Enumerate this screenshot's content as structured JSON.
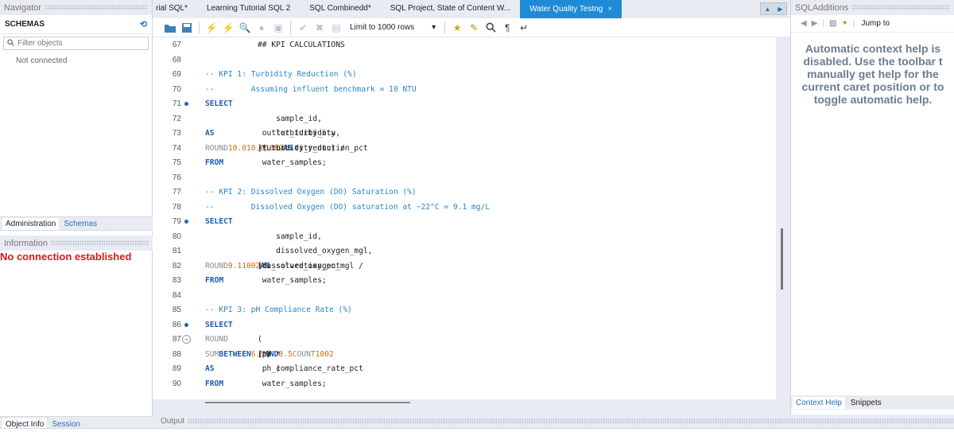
{
  "navigator": {
    "title": "Navigator",
    "schemas_label": "SCHEMAS",
    "filter_placeholder": "Filter objects",
    "status": "Not connected",
    "tabs": [
      "Administration",
      "Schemas"
    ],
    "info_title": "Information",
    "no_connection": "No connection established",
    "bottom_tabs": [
      "Object Info",
      "Session"
    ]
  },
  "document_tabs": [
    {
      "label": "rial SQL*"
    },
    {
      "label": "Learning Tutorial SQL 2"
    },
    {
      "label": "SQL Combinedd*"
    },
    {
      "label": "SQL Project, State of Content W..."
    },
    {
      "label": "Water Quality Testng",
      "active": true,
      "close": "×"
    }
  ],
  "toolbar": {
    "limit_label": "Limit to 1000 rows",
    "dropdown_arrow": "▾"
  },
  "editor": {
    "lines": [
      {
        "n": "67",
        "parts": [
          {
            "t": "## KPI CALCULATIONS",
            "c": "code"
          }
        ]
      },
      {
        "n": "68",
        "parts": []
      },
      {
        "n": "69",
        "parts": [
          {
            "t": "-- KPI 1: Turbidity Reduction (%)",
            "c": "cm"
          }
        ]
      },
      {
        "n": "70",
        "parts": [
          {
            "t": "--        Assuming influent benchmark = 10 NTU",
            "c": "cm"
          }
        ]
      },
      {
        "n": "71",
        "mark": true,
        "parts": [
          {
            "t": "SELECT",
            "c": "kw"
          }
        ]
      },
      {
        "n": "72",
        "parts": [
          {
            "t": "    sample_id,",
            "c": "code"
          }
        ]
      },
      {
        "n": "73",
        "parts": [
          {
            "t": "    turbidity_ntu ",
            "c": "code"
          },
          {
            "t": "AS",
            "c": "kw"
          },
          {
            "t": " outlet_turbidity,",
            "c": "code"
          }
        ]
      },
      {
        "n": "74",
        "parts": [
          {
            "t": "    ",
            "c": "code"
          },
          {
            "t": "ROUND",
            "c": "fn"
          },
          {
            "t": "((",
            "c": "code"
          },
          {
            "t": "10.0",
            "c": "num"
          },
          {
            "t": " - turbidity_ntu) / ",
            "c": "code"
          },
          {
            "t": "10.0",
            "c": "num"
          },
          {
            "t": " * ",
            "c": "code"
          },
          {
            "t": "100",
            "c": "num"
          },
          {
            "t": ", ",
            "c": "code"
          },
          {
            "t": "2",
            "c": "num"
          },
          {
            "t": ") ",
            "c": "code"
          },
          {
            "t": "AS",
            "c": "kw"
          },
          {
            "t": " turbidity_reduction_pct",
            "c": "code"
          }
        ]
      },
      {
        "n": "75",
        "parts": [
          {
            "t": "FROM",
            "c": "kw"
          },
          {
            "t": " water_samples;",
            "c": "code"
          }
        ]
      },
      {
        "n": "76",
        "parts": []
      },
      {
        "n": "77",
        "parts": [
          {
            "t": "-- KPI 2: Dissolved Oxygen (DO) Saturation (%)",
            "c": "cm"
          }
        ]
      },
      {
        "n": "78",
        "parts": [
          {
            "t": "--        Dissolved Oxygen (DO) saturation at ~22°C = 9.1 mg/L",
            "c": "cm"
          }
        ]
      },
      {
        "n": "79",
        "mark": true,
        "parts": [
          {
            "t": "SELECT",
            "c": "kw"
          }
        ]
      },
      {
        "n": "80",
        "parts": [
          {
            "t": "    sample_id,",
            "c": "code"
          }
        ]
      },
      {
        "n": "81",
        "parts": [
          {
            "t": "    dissolved_oxygen_mgl,",
            "c": "code"
          }
        ]
      },
      {
        "n": "82",
        "parts": [
          {
            "t": "    ",
            "c": "code"
          },
          {
            "t": "ROUND",
            "c": "fn"
          },
          {
            "t": "(dissolved_oxygen_mgl / ",
            "c": "code"
          },
          {
            "t": "9.1",
            "c": "num"
          },
          {
            "t": " * ",
            "c": "code"
          },
          {
            "t": "100",
            "c": "num"
          },
          {
            "t": ", ",
            "c": "code"
          },
          {
            "t": "2",
            "c": "num"
          },
          {
            "t": ") ",
            "c": "code"
          },
          {
            "t": "AS",
            "c": "kw"
          },
          {
            "t": " do_saturation_pct",
            "c": "code"
          }
        ]
      },
      {
        "n": "83",
        "parts": [
          {
            "t": "FROM",
            "c": "kw"
          },
          {
            "t": " water_samples;",
            "c": "code"
          }
        ]
      },
      {
        "n": "84",
        "parts": []
      },
      {
        "n": "85",
        "parts": [
          {
            "t": "-- KPI 3: pH Compliance Rate (%)",
            "c": "cm"
          }
        ]
      },
      {
        "n": "86",
        "mark": true,
        "parts": [
          {
            "t": "SELECT",
            "c": "kw"
          }
        ]
      },
      {
        "n": "87",
        "fold": true,
        "parts": [
          {
            "t": "    ",
            "c": "code"
          },
          {
            "t": "ROUND",
            "c": "fn"
          },
          {
            "t": "(",
            "c": "code"
          }
        ]
      },
      {
        "n": "88",
        "parts": [
          {
            "t": "        ",
            "c": "code"
          },
          {
            "t": "SUM",
            "c": "fn"
          },
          {
            "t": "(pH ",
            "c": "code"
          },
          {
            "t": "BETWEEN",
            "c": "kw"
          },
          {
            "t": " ",
            "c": "code"
          },
          {
            "t": "6.5",
            "c": "num"
          },
          {
            "t": " ",
            "c": "code"
          },
          {
            "t": "AND",
            "c": "kw"
          },
          {
            "t": " ",
            "c": "code"
          },
          {
            "t": "8.5",
            "c": "num"
          },
          {
            "t": ") / ",
            "c": "code"
          },
          {
            "t": "COUNT",
            "c": "fn"
          },
          {
            "t": "(*) * ",
            "c": "code"
          },
          {
            "t": "100",
            "c": "num"
          },
          {
            "t": ", ",
            "c": "code"
          },
          {
            "t": "2",
            "c": "num"
          }
        ]
      },
      {
        "n": "89",
        "parts": [
          {
            "t": "    ) ",
            "c": "code"
          },
          {
            "t": "AS",
            "c": "kw"
          },
          {
            "t": " ph_compliance_rate_pct",
            "c": "code"
          }
        ]
      },
      {
        "n": "90",
        "parts": [
          {
            "t": "FROM",
            "c": "kw"
          },
          {
            "t": " water_samples;",
            "c": "code"
          }
        ]
      }
    ]
  },
  "output": {
    "title": "Output"
  },
  "sql_additions": {
    "title": "SQLAdditions",
    "jump_to": "Jump to",
    "help_text": "Automatic context help is\ndisabled. Use the toolbar t\nmanually get help for the\ncurrent caret position or to\ntoggle automatic help.",
    "tabs": [
      "Context Help",
      "Snippets"
    ]
  },
  "colors": {
    "accent": "#1f8ad6",
    "error": "#e0151b",
    "keyword": "#1a5fb4",
    "comment": "#2b86c8",
    "number": "#d46a00"
  }
}
